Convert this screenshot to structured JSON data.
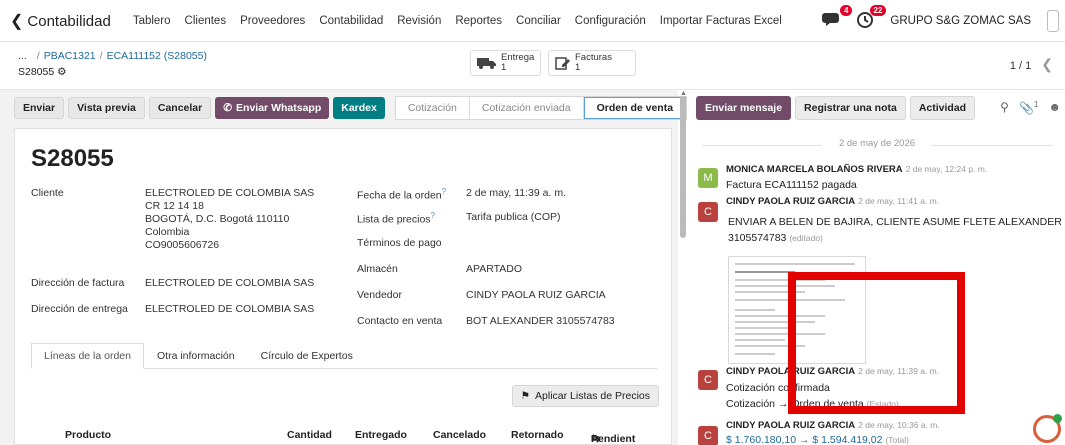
{
  "navbar": {
    "back_label": "Contabilidad",
    "menu": [
      "Tablero",
      "Clientes",
      "Proveedores",
      "Contabilidad",
      "Revisión",
      "Reportes",
      "Conciliar",
      "Configuración",
      "Importar Facturas Excel"
    ],
    "chat_count": "4",
    "activity_count": "22",
    "company": "GRUPO S&G ZOMAC SAS"
  },
  "breadcrumb": {
    "dots": "...",
    "items": [
      "PBAC1321",
      "ECA111152 (S28055)"
    ],
    "record": "S28055"
  },
  "smart_buttons": {
    "delivery_label": "Entrega",
    "delivery_count": "1",
    "invoices_label": "Facturas",
    "invoices_count": "1"
  },
  "pager": {
    "text": "1 / 1"
  },
  "actions": {
    "send": "Enviar",
    "preview": "Vista previa",
    "cancel": "Cancelar",
    "whatsapp": "Enviar Whatsapp",
    "kardex": "Kardex"
  },
  "stages": [
    "Cotización",
    "Cotización enviada",
    "Orden de venta"
  ],
  "form": {
    "name": "S28055",
    "customer_label": "Cliente",
    "customer_lines": [
      "ELECTROLED DE COLOMBIA SAS",
      "CR 12 14 18",
      "BOGOTÁ, D.C. Bogotá 110110",
      "Colombia",
      "CO9005606726"
    ],
    "invoice_addr_label": "Dirección de factura",
    "invoice_addr": "ELECTROLED DE COLOMBIA SAS",
    "delivery_addr_label": "Dirección de entrega",
    "delivery_addr": "ELECTROLED DE COLOMBIA SAS",
    "order_date_label": "Fecha de la orden",
    "order_date": "2 de may, 11:39 a. m.",
    "pricelist_label": "Lista de precios",
    "pricelist": "Tarifa publica (COP)",
    "payment_terms_label": "Términos de pago",
    "warehouse_label": "Almacén",
    "warehouse": "APARTADO",
    "salesperson_label": "Vendedor",
    "salesperson": "CINDY PAOLA RUIZ GARCIA",
    "contact_label": "Contacto en venta",
    "contact": "BOT ALEXANDER 3105574783",
    "help_mark": "?"
  },
  "tabs": [
    "Líneas de la orden",
    "Otra información",
    "Círculo de Expertos"
  ],
  "apply_pricelists": "Aplicar Listas de Precios",
  "table_headers": [
    "Producto",
    "Cantidad",
    "Entregado",
    "Cancelado",
    "Retornado",
    "Pendient"
  ],
  "chatter": {
    "send_message": "Enviar mensaje",
    "log_note": "Registrar una nota",
    "activity": "Actividad",
    "attachments_count": "1",
    "date_separator": "2 de may de 2026",
    "messages": [
      {
        "initial": "M",
        "author": "MONICA MARCELA BOLAÑOS RIVERA",
        "time": "2 de may, 12:24 p. m.",
        "body": "Factura ECA111152 pagada"
      },
      {
        "initial": "C",
        "author": "CINDY PAOLA RUIZ GARCIA",
        "time": "2 de may, 11:41 a. m.",
        "body": "ENVIAR A BELEN DE BAJIRA, CLIENTE ASUME FLETE ALEXANDER PIZA",
        "body2": "3105574783",
        "edited": "(editado)"
      },
      {
        "initial": "C",
        "author": "CINDY PAOLA RUIZ GARCIA",
        "time": "2 de may, 11:39 a. m.",
        "body": "Cotización confirmada",
        "body2": "Cotización → Orden de venta",
        "body2_extra": "(Estado)"
      },
      {
        "initial": "C",
        "author": "CINDY PAOLA RUIZ GARCIA",
        "time": "2 de may, 10:36 a. m.",
        "body": "$ 1.760.180,10 → $ 1.594.419,02",
        "body_extra": "(Total)"
      }
    ]
  },
  "colors": {
    "primary": "#714b67",
    "teal": "#017e84",
    "link": "#1f6a9c",
    "highlight_box": "#e20000"
  }
}
